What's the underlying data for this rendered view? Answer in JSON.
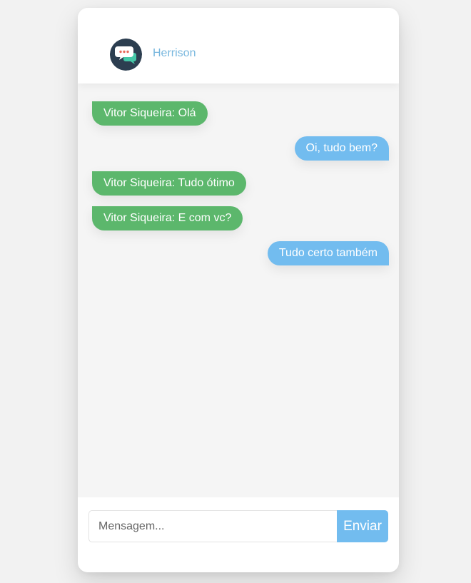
{
  "theme": {
    "received_color": "#5cb76c",
    "sent_color": "#72bcef",
    "contact_name_color": "#78b7de",
    "avatar_bg": "#2c3e50",
    "avatar_icons": [
      "speech-bubble-icon",
      "typing-dots-icon"
    ]
  },
  "header": {
    "contact_name": "Herrison"
  },
  "messages": [
    {
      "direction": "received",
      "text": "Vitor Siqueira: Olá"
    },
    {
      "direction": "sent",
      "text": "Oi, tudo bem?"
    },
    {
      "direction": "received",
      "text": "Vitor Siqueira: Tudo ótimo"
    },
    {
      "direction": "received",
      "text": "Vitor Siqueira: E com vc?"
    },
    {
      "direction": "sent",
      "text": "Tudo certo também"
    }
  ],
  "composer": {
    "input_value": "",
    "input_placeholder": "Mensagem...",
    "send_label": "Enviar"
  }
}
